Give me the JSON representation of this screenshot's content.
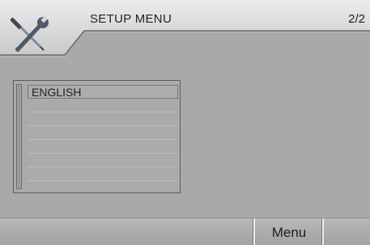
{
  "header": {
    "title": "SETUP MENU",
    "page_indicator": "2/2",
    "icon": "tools-icon"
  },
  "language_list": {
    "items": [
      "ENGLISH"
    ],
    "selected": "ENGLISH",
    "empty_rows": 6
  },
  "footer": {
    "menu_label": "Menu"
  },
  "colors": {
    "background": "#a9a9a9",
    "header_bar": "#dcdcdc"
  }
}
